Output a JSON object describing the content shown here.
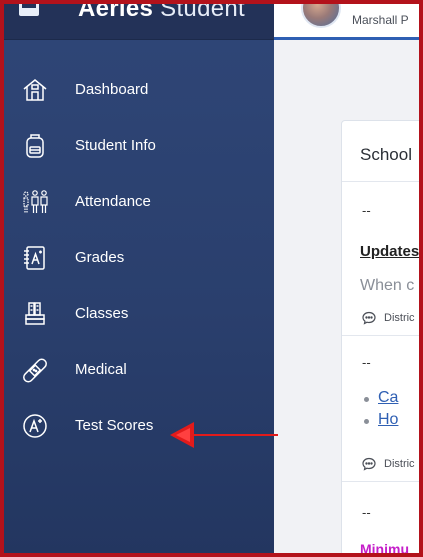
{
  "app": {
    "brand_bold": "Aeries",
    "brand_light": "Student"
  },
  "user": {
    "name": "Marshall P"
  },
  "sidebar": {
    "items": [
      {
        "label": "Dashboard",
        "icon": "house-icon"
      },
      {
        "label": "Student Info",
        "icon": "backpack-icon"
      },
      {
        "label": "Attendance",
        "icon": "people-icon"
      },
      {
        "label": "Grades",
        "icon": "grade-book-icon"
      },
      {
        "label": "Classes",
        "icon": "books-icon"
      },
      {
        "label": "Medical",
        "icon": "bandage-icon"
      },
      {
        "label": "Test Scores",
        "icon": "a-plus-icon"
      }
    ]
  },
  "main": {
    "card_title": "School",
    "dash1": "--",
    "update_title": "Updates",
    "update_text": "When c",
    "district1": "Distric",
    "dash2": "--",
    "links": [
      "Ca",
      "Ho"
    ],
    "district2": "Distric",
    "dash3": "--",
    "minimum_text": "Minimu"
  },
  "colors": {
    "sidebar": "#2a3f6d",
    "frame_border": "#b3121b",
    "accent_blue": "#2f5fb3",
    "highlight_magenta": "#c51ec9",
    "annotation_red": "#e21b1b"
  }
}
